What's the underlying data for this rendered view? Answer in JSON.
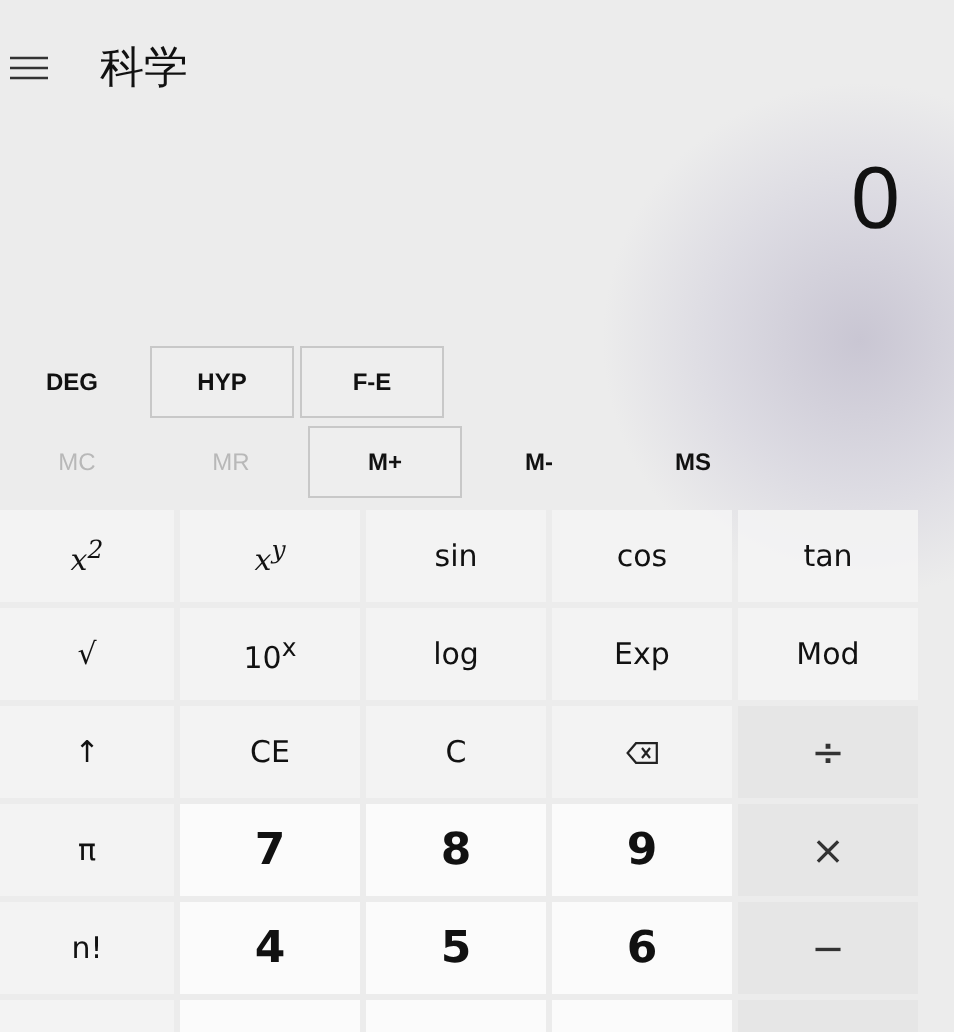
{
  "header": {
    "title": "科学"
  },
  "display": {
    "value": "0"
  },
  "mode_buttons": [
    {
      "label": "DEG",
      "outlined": false
    },
    {
      "label": "HYP",
      "outlined": true
    },
    {
      "label": "F-E",
      "outlined": true
    }
  ],
  "memory_buttons": [
    {
      "label": "MC",
      "disabled": true,
      "outlined": false
    },
    {
      "label": "MR",
      "disabled": true,
      "outlined": false
    },
    {
      "label": "M+",
      "disabled": false,
      "outlined": true
    },
    {
      "label": "M-",
      "disabled": false,
      "outlined": false
    },
    {
      "label": "MS",
      "disabled": false,
      "outlined": false
    }
  ],
  "keys": [
    {
      "label": "x$^{2}$",
      "kind": "math"
    },
    {
      "label": "x$^{y}$",
      "kind": "math"
    },
    {
      "label": "sin",
      "kind": "func"
    },
    {
      "label": "cos",
      "kind": "func"
    },
    {
      "label": "tan",
      "kind": "func"
    },
    {
      "label": "√",
      "kind": "func"
    },
    {
      "label": "10$^{x}$",
      "kind": "func"
    },
    {
      "label": "log",
      "kind": "func"
    },
    {
      "label": "Exp",
      "kind": "func"
    },
    {
      "label": "Mod",
      "kind": "func"
    },
    {
      "label": "↑",
      "kind": "func"
    },
    {
      "label": "CE",
      "kind": "func"
    },
    {
      "label": "C",
      "kind": "func"
    },
    {
      "kind": "backspace"
    },
    {
      "label": "÷",
      "kind": "op"
    },
    {
      "label": "π",
      "kind": "func"
    },
    {
      "label": "7",
      "kind": "digit"
    },
    {
      "label": "8",
      "kind": "digit"
    },
    {
      "label": "9",
      "kind": "digit"
    },
    {
      "label": "×",
      "kind": "op"
    },
    {
      "label": "n!",
      "kind": "func"
    },
    {
      "label": "4",
      "kind": "digit"
    },
    {
      "label": "5",
      "kind": "digit"
    },
    {
      "label": "6",
      "kind": "digit"
    },
    {
      "label": "−",
      "kind": "op"
    },
    {
      "kind": "func"
    },
    {
      "kind": "digit"
    },
    {
      "kind": "digit"
    },
    {
      "kind": "digit"
    },
    {
      "kind": "op"
    }
  ]
}
